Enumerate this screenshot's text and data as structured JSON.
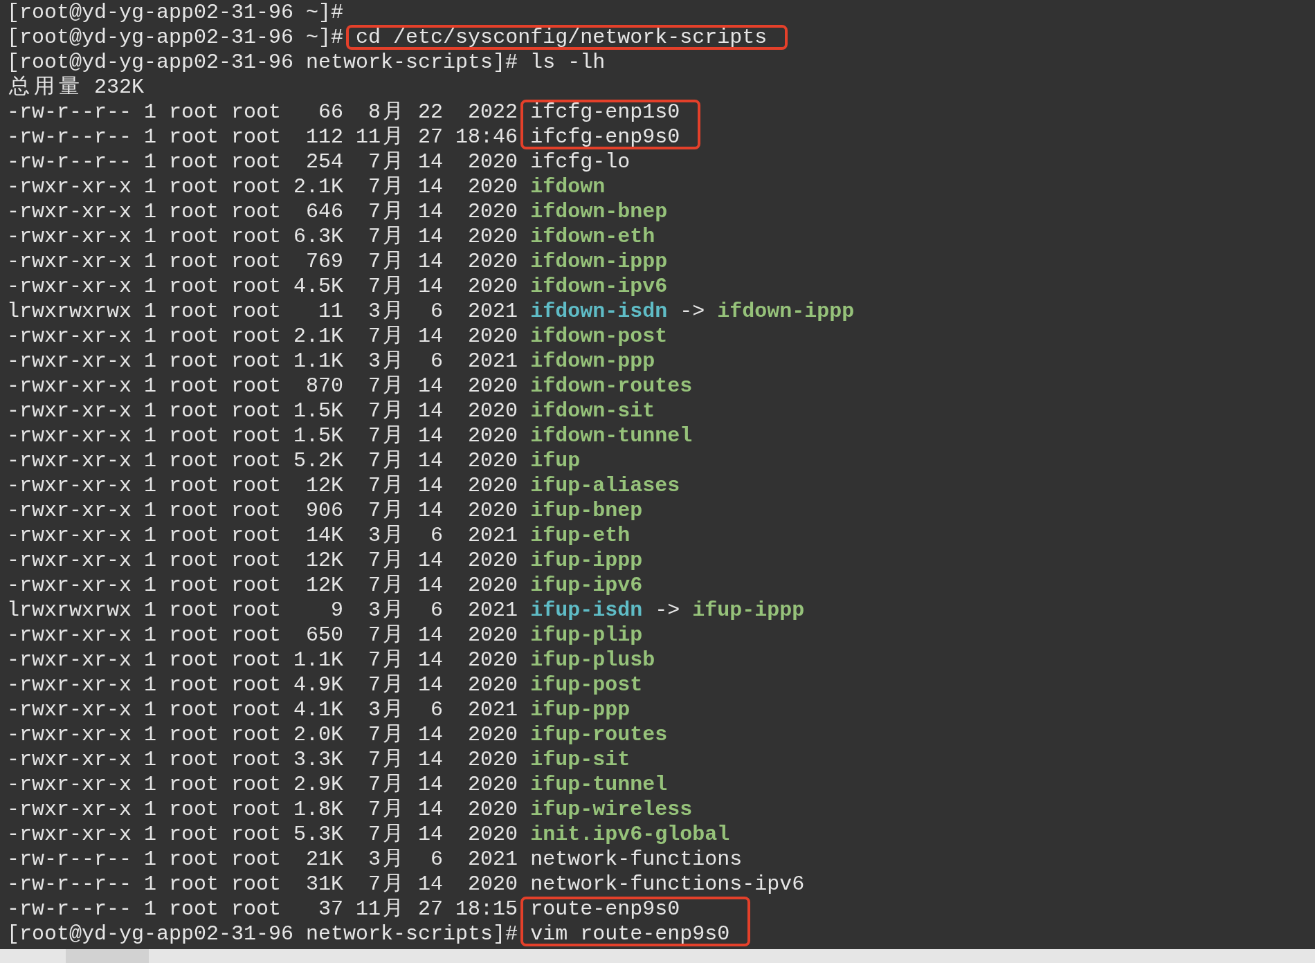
{
  "terminal": {
    "lines": [
      [
        {
          "text": "[root@yd-yg-app02-31-96 ~]#",
          "kind": "plain",
          "boxed": false
        }
      ],
      [
        {
          "text": "[root@yd-yg-app02-31-96 ~]# ",
          "kind": "plain",
          "boxed": false
        },
        {
          "text": "cd /etc/sysconfig/network-scripts",
          "kind": "plain",
          "boxed": true
        }
      ],
      [
        {
          "text": "[root@yd-yg-app02-31-96 network-scripts]# ls -lh",
          "kind": "plain",
          "boxed": false
        }
      ],
      [
        {
          "text": "总用量 232K",
          "kind": "plain",
          "boxed": false
        }
      ],
      [
        {
          "text": "-rw-r--r-- 1 root root   66  8月 22  2022 ",
          "kind": "plain",
          "boxed": false
        },
        {
          "text": "ifcfg-enp1s0",
          "kind": "plain",
          "boxed": true
        }
      ],
      [
        {
          "text": "-rw-r--r-- 1 root root  112 11月 27 18:46 ",
          "kind": "plain",
          "boxed": false
        },
        {
          "text": "ifcfg-enp9s0",
          "kind": "plain",
          "boxed": true
        }
      ],
      [
        {
          "text": "-rw-r--r-- 1 root root  254  7月 14  2020 ",
          "kind": "plain",
          "boxed": false
        },
        {
          "text": "ifcfg-lo",
          "kind": "plain",
          "boxed": false
        }
      ],
      [
        {
          "text": "-rwxr-xr-x 1 root root 2.1K  7月 14  2020 ",
          "kind": "plain",
          "boxed": false
        },
        {
          "text": "ifdown",
          "kind": "exec",
          "boxed": false
        }
      ],
      [
        {
          "text": "-rwxr-xr-x 1 root root  646  7月 14  2020 ",
          "kind": "plain",
          "boxed": false
        },
        {
          "text": "ifdown-bnep",
          "kind": "exec",
          "boxed": false
        }
      ],
      [
        {
          "text": "-rwxr-xr-x 1 root root 6.3K  7月 14  2020 ",
          "kind": "plain",
          "boxed": false
        },
        {
          "text": "ifdown-eth",
          "kind": "exec",
          "boxed": false
        }
      ],
      [
        {
          "text": "-rwxr-xr-x 1 root root  769  7月 14  2020 ",
          "kind": "plain",
          "boxed": false
        },
        {
          "text": "ifdown-ippp",
          "kind": "exec",
          "boxed": false
        }
      ],
      [
        {
          "text": "-rwxr-xr-x 1 root root 4.5K  7月 14  2020 ",
          "kind": "plain",
          "boxed": false
        },
        {
          "text": "ifdown-ipv6",
          "kind": "exec",
          "boxed": false
        }
      ],
      [
        {
          "text": "lrwxrwxrwx 1 root root   11  3月  6  2021 ",
          "kind": "plain",
          "boxed": false
        },
        {
          "text": "ifdown-isdn",
          "kind": "link",
          "boxed": false
        },
        {
          "text": " -> ",
          "kind": "plain",
          "boxed": false
        },
        {
          "text": "ifdown-ippp",
          "kind": "exec",
          "boxed": false
        }
      ],
      [
        {
          "text": "-rwxr-xr-x 1 root root 2.1K  7月 14  2020 ",
          "kind": "plain",
          "boxed": false
        },
        {
          "text": "ifdown-post",
          "kind": "exec",
          "boxed": false
        }
      ],
      [
        {
          "text": "-rwxr-xr-x 1 root root 1.1K  3月  6  2021 ",
          "kind": "plain",
          "boxed": false
        },
        {
          "text": "ifdown-ppp",
          "kind": "exec",
          "boxed": false
        }
      ],
      [
        {
          "text": "-rwxr-xr-x 1 root root  870  7月 14  2020 ",
          "kind": "plain",
          "boxed": false
        },
        {
          "text": "ifdown-routes",
          "kind": "exec",
          "boxed": false
        }
      ],
      [
        {
          "text": "-rwxr-xr-x 1 root root 1.5K  7月 14  2020 ",
          "kind": "plain",
          "boxed": false
        },
        {
          "text": "ifdown-sit",
          "kind": "exec",
          "boxed": false
        }
      ],
      [
        {
          "text": "-rwxr-xr-x 1 root root 1.5K  7月 14  2020 ",
          "kind": "plain",
          "boxed": false
        },
        {
          "text": "ifdown-tunnel",
          "kind": "exec",
          "boxed": false
        }
      ],
      [
        {
          "text": "-rwxr-xr-x 1 root root 5.2K  7月 14  2020 ",
          "kind": "plain",
          "boxed": false
        },
        {
          "text": "ifup",
          "kind": "exec",
          "boxed": false
        }
      ],
      [
        {
          "text": "-rwxr-xr-x 1 root root  12K  7月 14  2020 ",
          "kind": "plain",
          "boxed": false
        },
        {
          "text": "ifup-aliases",
          "kind": "exec",
          "boxed": false
        }
      ],
      [
        {
          "text": "-rwxr-xr-x 1 root root  906  7月 14  2020 ",
          "kind": "plain",
          "boxed": false
        },
        {
          "text": "ifup-bnep",
          "kind": "exec",
          "boxed": false
        }
      ],
      [
        {
          "text": "-rwxr-xr-x 1 root root  14K  3月  6  2021 ",
          "kind": "plain",
          "boxed": false
        },
        {
          "text": "ifup-eth",
          "kind": "exec",
          "boxed": false
        }
      ],
      [
        {
          "text": "-rwxr-xr-x 1 root root  12K  7月 14  2020 ",
          "kind": "plain",
          "boxed": false
        },
        {
          "text": "ifup-ippp",
          "kind": "exec",
          "boxed": false
        }
      ],
      [
        {
          "text": "-rwxr-xr-x 1 root root  12K  7月 14  2020 ",
          "kind": "plain",
          "boxed": false
        },
        {
          "text": "ifup-ipv6",
          "kind": "exec",
          "boxed": false
        }
      ],
      [
        {
          "text": "lrwxrwxrwx 1 root root    9  3月  6  2021 ",
          "kind": "plain",
          "boxed": false
        },
        {
          "text": "ifup-isdn",
          "kind": "link",
          "boxed": false
        },
        {
          "text": " -> ",
          "kind": "plain",
          "boxed": false
        },
        {
          "text": "ifup-ippp",
          "kind": "exec",
          "boxed": false
        }
      ],
      [
        {
          "text": "-rwxr-xr-x 1 root root  650  7月 14  2020 ",
          "kind": "plain",
          "boxed": false
        },
        {
          "text": "ifup-plip",
          "kind": "exec",
          "boxed": false
        }
      ],
      [
        {
          "text": "-rwxr-xr-x 1 root root 1.1K  7月 14  2020 ",
          "kind": "plain",
          "boxed": false
        },
        {
          "text": "ifup-plusb",
          "kind": "exec",
          "boxed": false
        }
      ],
      [
        {
          "text": "-rwxr-xr-x 1 root root 4.9K  7月 14  2020 ",
          "kind": "plain",
          "boxed": false
        },
        {
          "text": "ifup-post",
          "kind": "exec",
          "boxed": false
        }
      ],
      [
        {
          "text": "-rwxr-xr-x 1 root root 4.1K  3月  6  2021 ",
          "kind": "plain",
          "boxed": false
        },
        {
          "text": "ifup-ppp",
          "kind": "exec",
          "boxed": false
        }
      ],
      [
        {
          "text": "-rwxr-xr-x 1 root root 2.0K  7月 14  2020 ",
          "kind": "plain",
          "boxed": false
        },
        {
          "text": "ifup-routes",
          "kind": "exec",
          "boxed": false
        }
      ],
      [
        {
          "text": "-rwxr-xr-x 1 root root 3.3K  7月 14  2020 ",
          "kind": "plain",
          "boxed": false
        },
        {
          "text": "ifup-sit",
          "kind": "exec",
          "boxed": false
        }
      ],
      [
        {
          "text": "-rwxr-xr-x 1 root root 2.9K  7月 14  2020 ",
          "kind": "plain",
          "boxed": false
        },
        {
          "text": "ifup-tunnel",
          "kind": "exec",
          "boxed": false
        }
      ],
      [
        {
          "text": "-rwxr-xr-x 1 root root 1.8K  7月 14  2020 ",
          "kind": "plain",
          "boxed": false
        },
        {
          "text": "ifup-wireless",
          "kind": "exec",
          "boxed": false
        }
      ],
      [
        {
          "text": "-rwxr-xr-x 1 root root 5.3K  7月 14  2020 ",
          "kind": "plain",
          "boxed": false
        },
        {
          "text": "init.ipv6-global",
          "kind": "exec",
          "boxed": false
        }
      ],
      [
        {
          "text": "-rw-r--r-- 1 root root  21K  3月  6  2021 ",
          "kind": "plain",
          "boxed": false
        },
        {
          "text": "network-functions",
          "kind": "plain",
          "boxed": false
        }
      ],
      [
        {
          "text": "-rw-r--r-- 1 root root  31K  7月 14  2020 ",
          "kind": "plain",
          "boxed": false
        },
        {
          "text": "network-functions-ipv6",
          "kind": "plain",
          "boxed": false
        }
      ],
      [
        {
          "text": "-rw-r--r-- 1 root root   37 11月 27 18:15 ",
          "kind": "plain",
          "boxed": false
        },
        {
          "text": "route-enp9s0",
          "kind": "plain",
          "boxed": true
        }
      ],
      [
        {
          "text": "[root@yd-yg-app02-31-96 network-scripts]# ",
          "kind": "plain",
          "boxed": false
        },
        {
          "text": "vim route-enp9s0",
          "kind": "plain",
          "boxed": true
        }
      ]
    ]
  }
}
